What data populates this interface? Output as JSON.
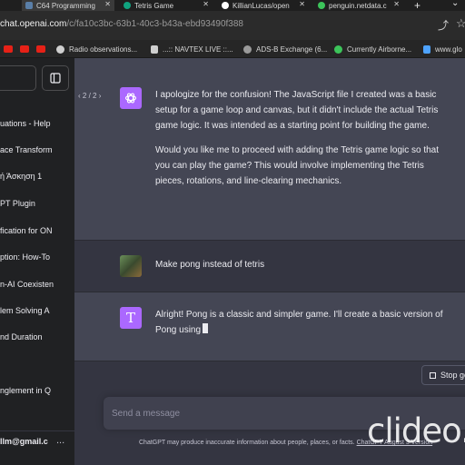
{
  "browser": {
    "tabs": [
      {
        "title": "C64 Programming",
        "active": true,
        "favicon_color": "#5a7fa8"
      },
      {
        "title": "Tetris Game",
        "active": false,
        "favicon_color": "#10a37f"
      },
      {
        "title": "KillianLucas/open",
        "active": false,
        "favicon_color": "#ffffff"
      },
      {
        "title": "penguin.netdata.c",
        "active": false,
        "favicon_color": "#3cc45a"
      }
    ],
    "new_tab_label": "+",
    "url_host": "chat.openai.com",
    "url_path": "/c/fa10c3bc-63b1-40c3-b43a-ebd93490f388",
    "bookmarks": [
      {
        "label": "",
        "icon": "youtube-icon",
        "color": "#e62117"
      },
      {
        "label": "",
        "icon": "youtube-icon",
        "color": "#e62117"
      },
      {
        "label": "",
        "icon": "youtube-icon",
        "color": "#e62117"
      },
      {
        "label": "Radio observations...",
        "icon": "globe-icon",
        "color": "#cfcfcf"
      },
      {
        "label": "...:: NAVTEX LIVE ::...",
        "icon": "doc-icon",
        "color": "#cfcfcf"
      },
      {
        "label": "ADS-B Exchange (6...",
        "icon": "adsb-icon",
        "color": "#9a9a9a"
      },
      {
        "label": "Currently Airborne...",
        "icon": "plane-icon",
        "color": "#3cc45a"
      },
      {
        "label": "www.glo",
        "icon": "glo-icon",
        "color": "#4ea3ff"
      }
    ]
  },
  "sidebar": {
    "items": [
      "uations - Help",
      "ace Transform",
      "ή Άσκηση 1",
      "PT Plugin",
      "fication for ON",
      "ption: How-To",
      "n-AI Coexisten",
      "lem Solving A",
      "nd Duration",
      "",
      "nglement in Q"
    ],
    "user_email": "llm@gmail.c",
    "more_label": "..."
  },
  "conversation": {
    "pager": "2 / 2",
    "assistant1": {
      "paragraphs": [
        "I apologize for the confusion! The JavaScript file I created was a basic setup for a game loop and canvas, but it didn't include the actual Tetris game logic. It was intended as a starting point for building the game.",
        "Would you like me to proceed with adding the Tetris game logic so that you can play the game? This would involve implementing the Tetris pieces, rotations, and line-clearing mechanics."
      ]
    },
    "user": {
      "text": "Make pong instead of tetris"
    },
    "assistant2": {
      "avatar_letter": "T",
      "text": "Alright! Pong is a classic and simpler game. I'll create a basic version of Pong using"
    }
  },
  "stop_button": "Stop ge",
  "composer": {
    "placeholder": "Send a message"
  },
  "disclaimer": {
    "text": "ChatGPT may produce inaccurate information about people, places, or facts.",
    "link": "ChatGPT August 3 Version"
  },
  "watermark": "clideo.com",
  "colors": {
    "accent": "#ab68ff",
    "assistant_bg": "#444654",
    "sidebar_bg": "#202123"
  }
}
